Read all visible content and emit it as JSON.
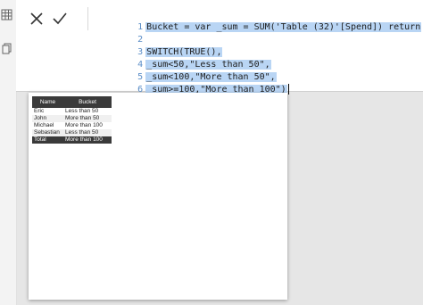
{
  "rail": {
    "icons": [
      "table-grid-icon",
      "copy-icon"
    ]
  },
  "formula_bar": {
    "actions": [
      "cancel-icon",
      "commit-icon"
    ],
    "lines": [
      {
        "num": "1",
        "text": "Bucket = var _sum = SUM('Table (32)'[Spend]) return"
      },
      {
        "num": "2",
        "text": ""
      },
      {
        "num": "3",
        "text": "SWITCH(TRUE(),"
      },
      {
        "num": "4",
        "text": "_sum<50,\"Less than 50\","
      },
      {
        "num": "5",
        "text": "_sum<100,\"More than 50\","
      },
      {
        "num": "6",
        "text": "_sum>=100,\"More than 100\")"
      }
    ]
  },
  "table": {
    "headers": [
      "Name",
      "Bucket"
    ],
    "rows": [
      [
        "Eric",
        "Less than 50"
      ],
      [
        "John",
        "More than 50"
      ],
      [
        "Michael",
        "More than 100"
      ],
      [
        "Sebastian",
        "Less than 50"
      ]
    ],
    "total": [
      "Total",
      "More than 100"
    ]
  },
  "colors": {
    "selection": "#b9d5f4",
    "line_number": "#5a8dc7",
    "header_bg": "#3a3a3a",
    "background": "#e6e6e6"
  }
}
